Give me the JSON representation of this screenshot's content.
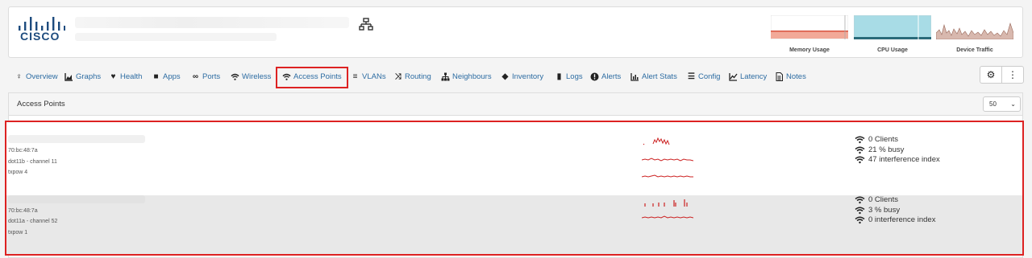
{
  "device": {
    "graphs": [
      {
        "caption": "Memory Usage"
      },
      {
        "caption": "CPU Usage"
      },
      {
        "caption": "Device Traffic"
      }
    ]
  },
  "nav": [
    {
      "label": "Overview",
      "icon": "lightbulb-icon"
    },
    {
      "label": "Graphs",
      "icon": "area-chart-icon"
    },
    {
      "label": "Health",
      "icon": "heartbeat-icon"
    },
    {
      "label": "Apps",
      "icon": "cubes-icon"
    },
    {
      "label": "Ports",
      "icon": "link-icon"
    },
    {
      "label": "Wireless",
      "icon": "wifi-icon"
    },
    {
      "label": "Access Points",
      "icon": "wifi-icon",
      "active": true
    },
    {
      "label": "VLANs",
      "icon": "vlan-icon"
    },
    {
      "label": "Routing",
      "icon": "random-icon"
    },
    {
      "label": "Neighbours",
      "icon": "sitemap-icon"
    },
    {
      "label": "Inventory",
      "icon": "cube-icon"
    },
    {
      "label": "Logs",
      "icon": "book-icon"
    },
    {
      "label": "Alerts",
      "icon": "exclamation-circle-icon"
    },
    {
      "label": "Alert Stats",
      "icon": "bar-chart-icon"
    },
    {
      "label": "Config",
      "icon": "align-justify-icon"
    },
    {
      "label": "Latency",
      "icon": "line-chart-icon"
    },
    {
      "label": "Notes",
      "icon": "file-text-icon"
    }
  ],
  "panel": {
    "title": "Access Points",
    "per_page": "50"
  },
  "access_points": [
    {
      "mac": "70:bc:48:7a",
      "radio": "dot11b - channel 11",
      "txpow": "txpow 4",
      "clients": "0 Clients",
      "busy": "21 % busy",
      "interference": "47 interference index"
    },
    {
      "mac": "70:bc:48:7a",
      "radio": "dot11a - channel 52",
      "txpow": "txpow 1",
      "clients": "0 Clients",
      "busy": "3 % busy",
      "interference": "0 interference index"
    }
  ],
  "colors": {
    "link": "#2d6ca2",
    "highlight": "#dd2222",
    "spark": "#cc2222"
  }
}
